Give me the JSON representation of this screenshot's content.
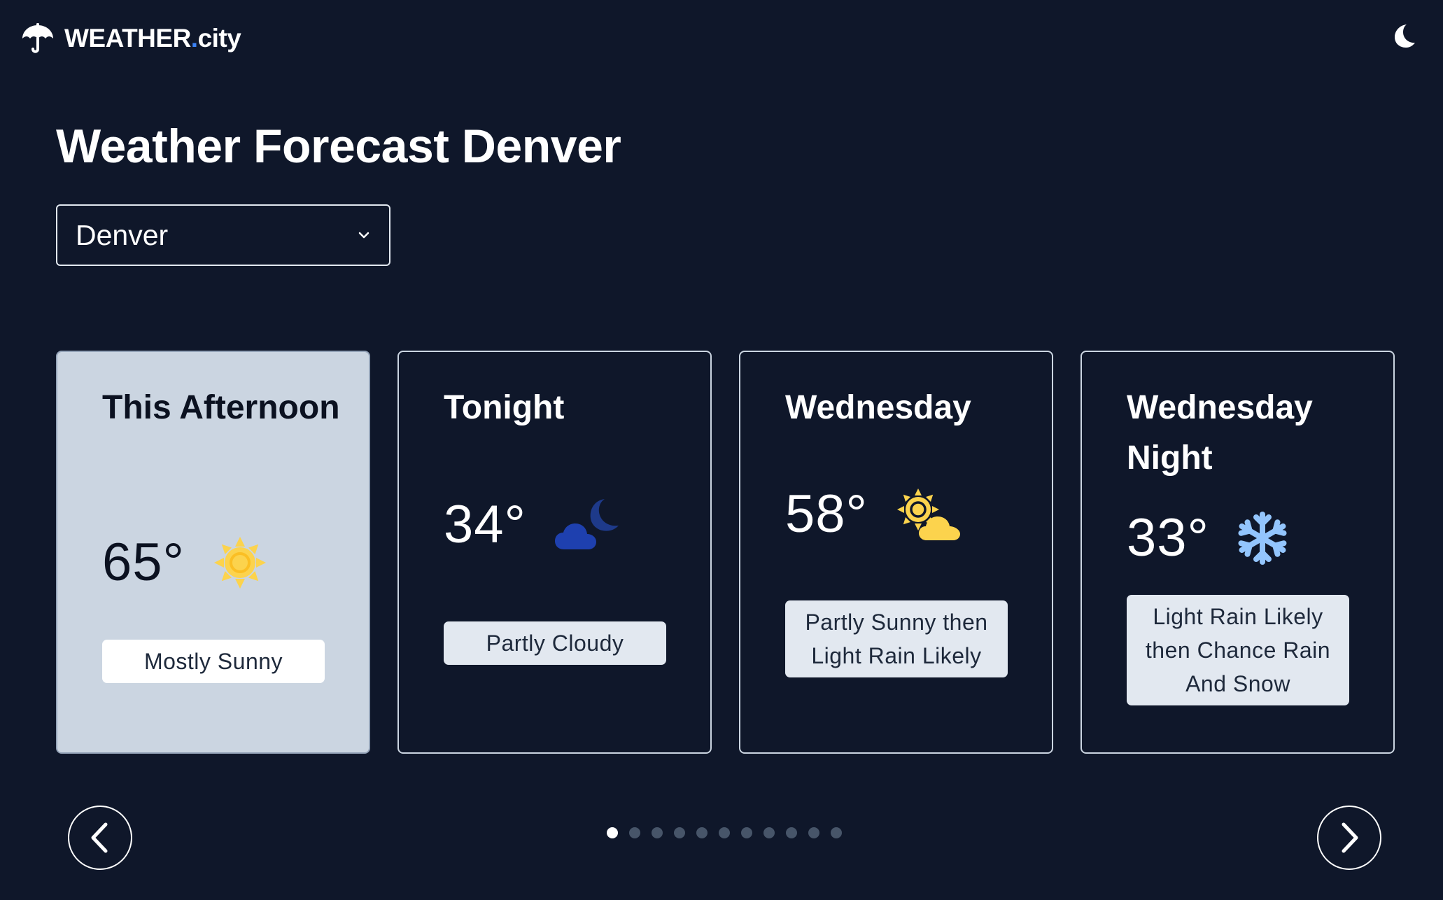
{
  "brand": {
    "name_main": "WEATHER",
    "name_dot": ".",
    "name_suffix": "city",
    "accent": "#3b82f6",
    "logo_icon": "umbrella-icon"
  },
  "header": {
    "theme_toggle_icon": "moon-icon"
  },
  "page": {
    "title": "Weather Forecast Denver",
    "background": "#0f172a"
  },
  "city_select": {
    "value": "Denver",
    "icon": "chevron-down-icon"
  },
  "forecast": [
    {
      "period": "This Afternoon",
      "temperature": "65°",
      "icon": "sun-icon",
      "description": "Mostly Sunny",
      "active": true
    },
    {
      "period": "Tonight",
      "temperature": "34°",
      "icon": "cloud-moon-icon",
      "description": "Partly Cloudy",
      "active": false
    },
    {
      "period": "Wednesday",
      "temperature": "58°",
      "icon": "sun-cloud-icon",
      "description": "Partly Sunny then Light Rain Likely",
      "active": false
    },
    {
      "period": "Wednesday Night",
      "temperature": "33°",
      "icon": "snowflake-icon",
      "description": "Light Rain Likely then Chance Rain And Snow",
      "active": false
    }
  ],
  "carousel": {
    "prev_icon": "chevron-left-icon",
    "next_icon": "chevron-right-icon",
    "page_count": 11,
    "active_page": 1
  },
  "colors": {
    "sun": "#fcd34d",
    "sun_stroke": "#fbbf24",
    "moon": "#1e3a8a",
    "snow": "#93c5fd",
    "active_card": "#cbd5e1"
  }
}
